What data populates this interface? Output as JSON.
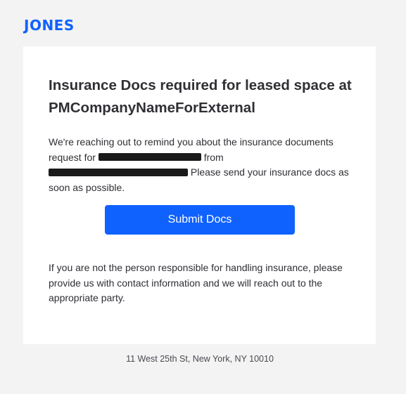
{
  "brand": {
    "logo_text": "JONES",
    "accent_color": "#0f62fe"
  },
  "email": {
    "title": "Insurance Docs required for leased space at PMCompanyNameForExternal",
    "intro_part1": "We're reaching out to remind you about the insurance documents request for ",
    "intro_part2": " from ",
    "intro_part3": " Please send your insurance docs as soon as possible.",
    "submit_label": "Submit Docs",
    "footnote": "If you are not the person responsible for handling insurance, please provide us with contact information and we will reach out to the appropriate party."
  },
  "footer": {
    "address": "11 West 25th St, New York, NY 10010"
  }
}
